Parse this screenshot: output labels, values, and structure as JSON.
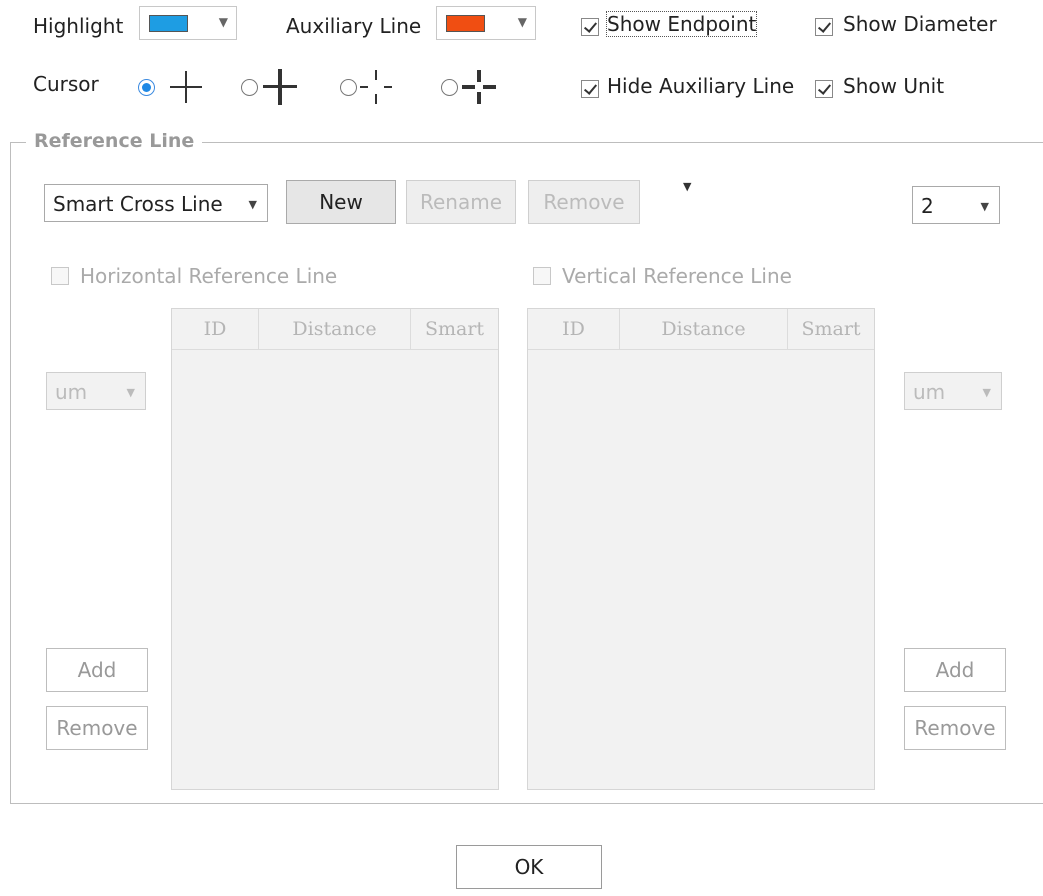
{
  "top": {
    "highlight_label": "Highlight",
    "highlight_color": "#1e9de3",
    "auxiliary_label": "Auxiliary Line",
    "auxiliary_color": "#f04e12",
    "show_endpoint": {
      "label": "Show Endpoint",
      "checked": true
    },
    "show_diameter": {
      "label": "Show Diameter",
      "checked": true
    },
    "hide_auxiliary": {
      "label": "Hide Auxiliary Line",
      "checked": true
    },
    "show_unit": {
      "label": "Show Unit",
      "checked": true
    },
    "cursor_label": "Cursor",
    "cursor_options": [
      "thin-cross",
      "thick-cross",
      "dashed-cross",
      "thick-gap-cross"
    ],
    "cursor_selected": 0
  },
  "reference": {
    "title": "Reference Line",
    "mode_select": "Smart Cross Line",
    "new_label": "New",
    "rename_label": "Rename",
    "remove_label": "Remove",
    "count_select": "2",
    "horizontal": {
      "checkbox_label": "Horizontal Reference Line",
      "unit": "um",
      "add_label": "Add",
      "remove_label": "Remove",
      "columns": [
        "ID",
        "Distance",
        "Smart"
      ]
    },
    "vertical": {
      "checkbox_label": "Vertical Reference Line",
      "unit": "um",
      "add_label": "Add",
      "remove_label": "Remove",
      "columns": [
        "ID",
        "Distance",
        "Smart"
      ]
    }
  },
  "ok_label": "OK"
}
